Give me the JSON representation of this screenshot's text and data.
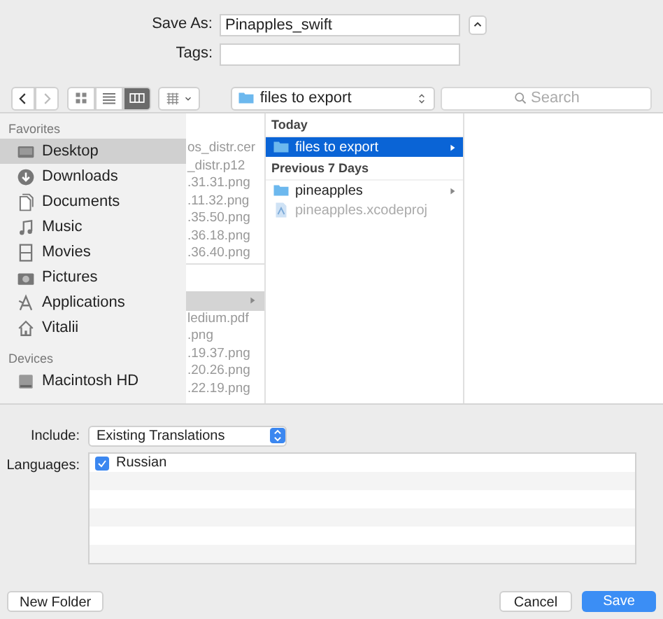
{
  "save_as": {
    "label": "Save As:",
    "value": "Pinapples_swift"
  },
  "tags": {
    "label": "Tags:"
  },
  "toolbar": {
    "view_modes": [
      {
        "kind": "icons",
        "selected": false
      },
      {
        "kind": "list",
        "selected": false
      },
      {
        "kind": "columns",
        "selected": true
      }
    ],
    "location": "files to export",
    "search": {
      "placeholder": "Search"
    }
  },
  "sidebar": {
    "sections": [
      {
        "title": "Favorites",
        "items": [
          {
            "label": "Desktop",
            "kind": "desktop",
            "selected": true
          },
          {
            "label": "Downloads",
            "kind": "downloads",
            "selected": false
          },
          {
            "label": "Documents",
            "kind": "documents",
            "selected": false
          },
          {
            "label": "Music",
            "kind": "music",
            "selected": false
          },
          {
            "label": "Movies",
            "kind": "movies",
            "selected": false
          },
          {
            "label": "Pictures",
            "kind": "pictures",
            "selected": false
          },
          {
            "label": "Applications",
            "kind": "applications",
            "selected": false
          },
          {
            "label": "Vitalii",
            "kind": "home",
            "selected": false
          }
        ]
      },
      {
        "title": "Devices",
        "items": [
          {
            "label": "Macintosh HD",
            "kind": "disk",
            "selected": false
          }
        ]
      }
    ]
  },
  "columns": [
    {
      "items": [
        {
          "kind": "file",
          "label": "os_distr.cer"
        },
        {
          "kind": "file",
          "label": "_distr.p12"
        },
        {
          "kind": "file",
          "label": ".31.31.png"
        },
        {
          "kind": "file",
          "label": ".11.32.png"
        },
        {
          "kind": "file",
          "label": ".35.50.png"
        },
        {
          "kind": "file",
          "label": ".36.18.png"
        },
        {
          "kind": "file",
          "label": ".36.40.png"
        },
        {
          "kind": "gap"
        },
        {
          "kind": "folder",
          "selected": true
        },
        {
          "kind": "file",
          "label": "ledium.pdf"
        },
        {
          "kind": "file",
          "label": ".png"
        },
        {
          "kind": "file",
          "label": ".19.37.png"
        },
        {
          "kind": "file",
          "label": ".20.26.png"
        },
        {
          "kind": "file",
          "label": ".22.19.png"
        }
      ]
    },
    {
      "items": [
        {
          "kind": "header",
          "label": "Today"
        },
        {
          "kind": "folder",
          "label": "files to export",
          "selected": true
        },
        {
          "kind": "header",
          "label": "Previous 7 Days"
        },
        {
          "kind": "folder",
          "label": "pineapples",
          "selected": false
        },
        {
          "kind": "project",
          "label": "pineapples.xcodeproj"
        }
      ]
    }
  ],
  "include": {
    "label": "Include:",
    "value": "Existing Translations"
  },
  "languages": {
    "label": "Languages:",
    "items": [
      {
        "label": "Russian",
        "checked": true
      }
    ]
  },
  "buttons": {
    "new_folder": "New Folder",
    "cancel": "Cancel",
    "save": "Save"
  }
}
